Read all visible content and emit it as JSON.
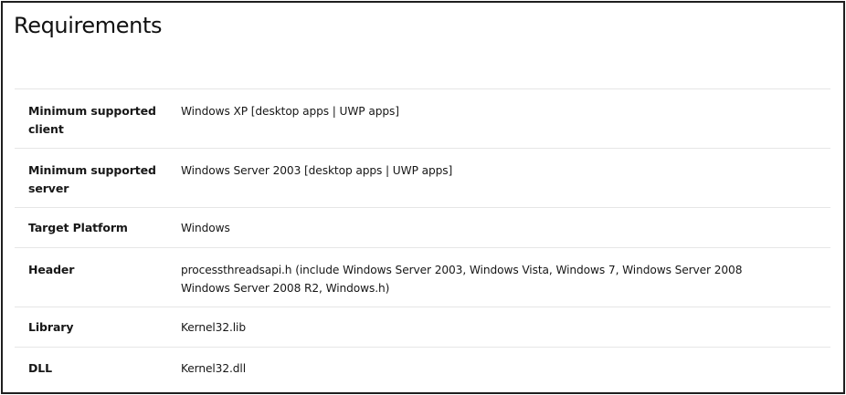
{
  "page": {
    "title": "Requirements"
  },
  "requirements": [
    {
      "label": "Minimum supported client",
      "value": "Windows XP [desktop apps | UWP apps]"
    },
    {
      "label": "Minimum supported server",
      "value": "Windows Server 2003 [desktop apps | UWP apps]"
    },
    {
      "label": "Target Platform",
      "value": "Windows"
    },
    {
      "label": "Header",
      "value": "processthreadsapi.h (include Windows Server 2003, Windows Vista, Windows 7, Windows Server 2008 Windows Server 2008 R2, Windows.h)"
    },
    {
      "label": "Library",
      "value": "Kernel32.lib"
    },
    {
      "label": "DLL",
      "value": "Kernel32.dll"
    }
  ]
}
